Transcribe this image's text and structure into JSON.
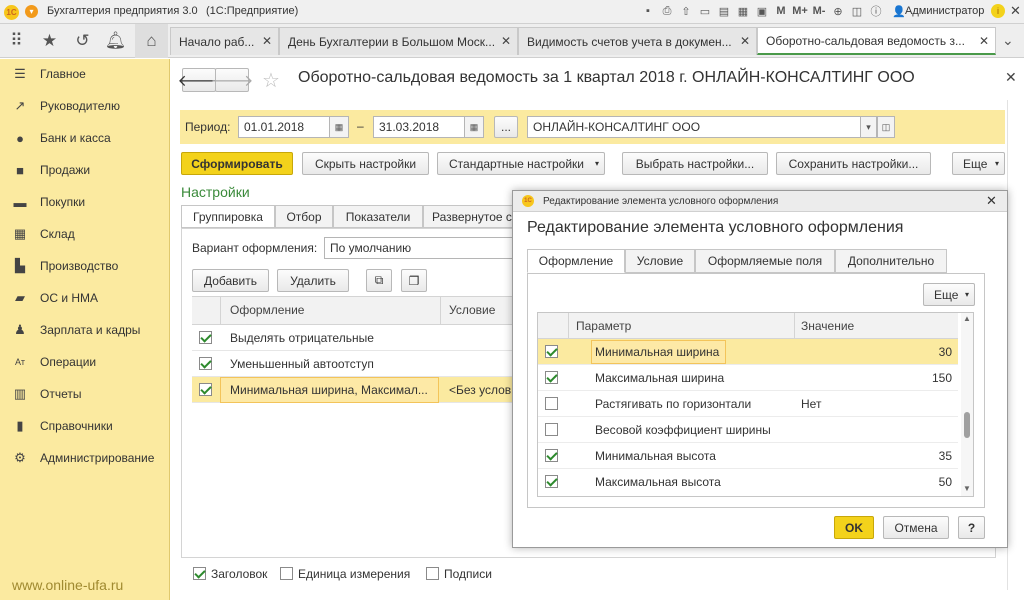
{
  "app": {
    "title": "Бухгалтерия предприятия 3.0",
    "platform": "(1С:Предприятие)",
    "user": "Администратор",
    "logo": "1С"
  },
  "tabs": [
    {
      "label": "Начало раб..."
    },
    {
      "label": "День Бухгалтерии в Большом Моск..."
    },
    {
      "label": "Видимость счетов учета в докумен..."
    },
    {
      "label": "Оборотно-сальдовая ведомость з..."
    }
  ],
  "sidebar": {
    "items": [
      {
        "label": "Главное",
        "icon": "menu-icon"
      },
      {
        "label": "Руководителю",
        "icon": "trend-icon"
      },
      {
        "label": "Банк и касса",
        "icon": "bank-icon"
      },
      {
        "label": "Продажи",
        "icon": "bag-icon"
      },
      {
        "label": "Покупки",
        "icon": "cart-icon"
      },
      {
        "label": "Склад",
        "icon": "warehouse-icon"
      },
      {
        "label": "Производство",
        "icon": "factory-icon"
      },
      {
        "label": "ОС и НМА",
        "icon": "truck-icon"
      },
      {
        "label": "Зарплата и кадры",
        "icon": "person-icon"
      },
      {
        "label": "Операции",
        "icon": "operations-icon"
      },
      {
        "label": "Отчеты",
        "icon": "report-icon"
      },
      {
        "label": "Справочники",
        "icon": "books-icon"
      },
      {
        "label": "Администрирование",
        "icon": "gear-icon"
      }
    ]
  },
  "watermark": "www.online-ufa.ru",
  "report": {
    "title": "Оборотно-сальдовая ведомость за 1 квартал 2018 г. ОНЛАЙН-КОНСАЛТИНГ ООО",
    "period_label": "Период:",
    "date_from": "01.01.2018",
    "dash": "–",
    "date_to": "31.03.2018",
    "ellipsis": "...",
    "organization": "ОНЛАЙН-КОНСАЛТИНГ ООО",
    "buttons": {
      "generate": "Сформировать",
      "hide": "Скрыть настройки",
      "standard": "Стандартные настройки",
      "choose": "Выбрать настройки...",
      "save": "Сохранить настройки...",
      "more": "Еще"
    },
    "settings_title": "Настройки",
    "settings_tabs": [
      "Группировка",
      "Отбор",
      "Показатели",
      "Развернутое с"
    ],
    "variant_label": "Вариант оформления:",
    "variant_value": "По умолчанию",
    "add": "Добавить",
    "delete": "Удалить",
    "col_format": "Оформление",
    "col_condition": "Условие",
    "rows": [
      {
        "text": "Выделять отрицательные",
        "checked": true,
        "condition": ""
      },
      {
        "text": "Уменьшенный автоотступ",
        "checked": true,
        "condition": ""
      },
      {
        "text": "Минимальная ширина, Максимал...",
        "checked": true,
        "condition": "<Без услов"
      }
    ],
    "footer": [
      {
        "label": "Заголовок",
        "checked": true
      },
      {
        "label": "Единица измерения",
        "checked": false
      },
      {
        "label": "Подписи",
        "checked": false
      }
    ]
  },
  "dialog": {
    "titlebar": "Редактирование элемента условного оформления",
    "heading": "Редактирование элемента условного оформления",
    "tabs": [
      "Оформление",
      "Условие",
      "Оформляемые поля",
      "Дополнительно"
    ],
    "more": "Еще",
    "col_param": "Параметр",
    "col_value": "Значение",
    "rows": [
      {
        "param": "Минимальная ширина",
        "value": "30",
        "checked": true
      },
      {
        "param": "Максимальная ширина",
        "value": "150",
        "checked": true
      },
      {
        "param": "Растягивать по горизонтали",
        "value": "Нет",
        "checked": false
      },
      {
        "param": "Весовой коэффициент ширины",
        "value": "",
        "checked": false
      },
      {
        "param": "Минимальная высота",
        "value": "35",
        "checked": true
      },
      {
        "param": "Максимальная высота",
        "value": "50",
        "checked": true
      }
    ],
    "ok": "OK",
    "cancel": "Отмена",
    "help": "?"
  },
  "colors": {
    "accent_yellow": "#f3d21b",
    "sidebar_bg": "#fbeaa0",
    "green_check": "#2d8a2d",
    "settings_green": "#3a8a3a"
  }
}
